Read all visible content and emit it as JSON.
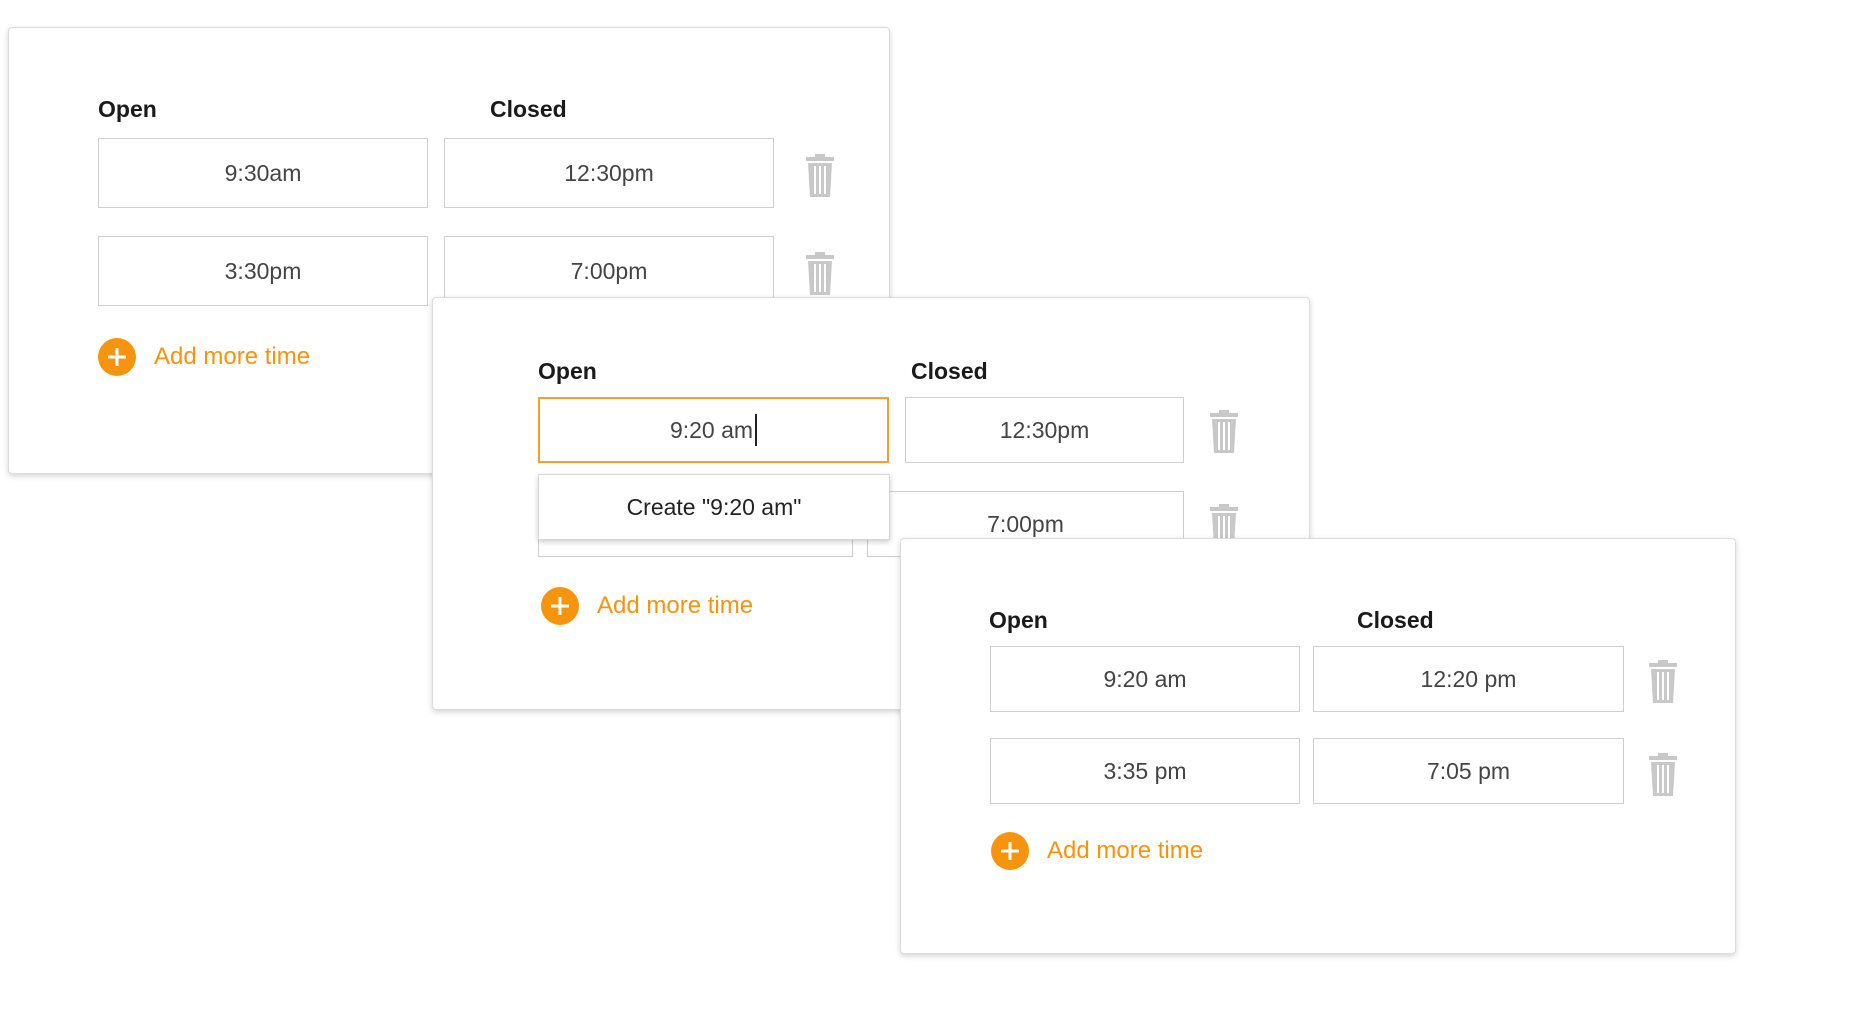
{
  "panel1": {
    "open_label": "Open",
    "closed_label": "Closed",
    "rows": [
      {
        "open": "9:30am",
        "closed": "12:30pm"
      },
      {
        "open": "3:30pm",
        "closed": "7:00pm"
      }
    ],
    "add_label": "Add more time"
  },
  "panel2": {
    "open_label": "Open",
    "closed_label": "Closed",
    "rows": [
      {
        "open": "9:20 am",
        "closed": "12:30pm"
      },
      {
        "open": "",
        "closed": "7:00pm"
      }
    ],
    "dropdown_option": "Create \"9:20 am\"",
    "add_label": "Add more time"
  },
  "panel3": {
    "open_label": "Open",
    "closed_label": "Closed",
    "rows": [
      {
        "open": "9:20 am",
        "closed": "12:20 pm"
      },
      {
        "open": "3:35 pm",
        "closed": "7:05 pm"
      }
    ],
    "add_label": "Add more time"
  },
  "colors": {
    "accent": "#f7940d",
    "focus_border": "#f0a030",
    "trash": "#c8c8c8"
  },
  "icons": {
    "trash": "trash-icon",
    "add": "plus-circle-icon"
  }
}
